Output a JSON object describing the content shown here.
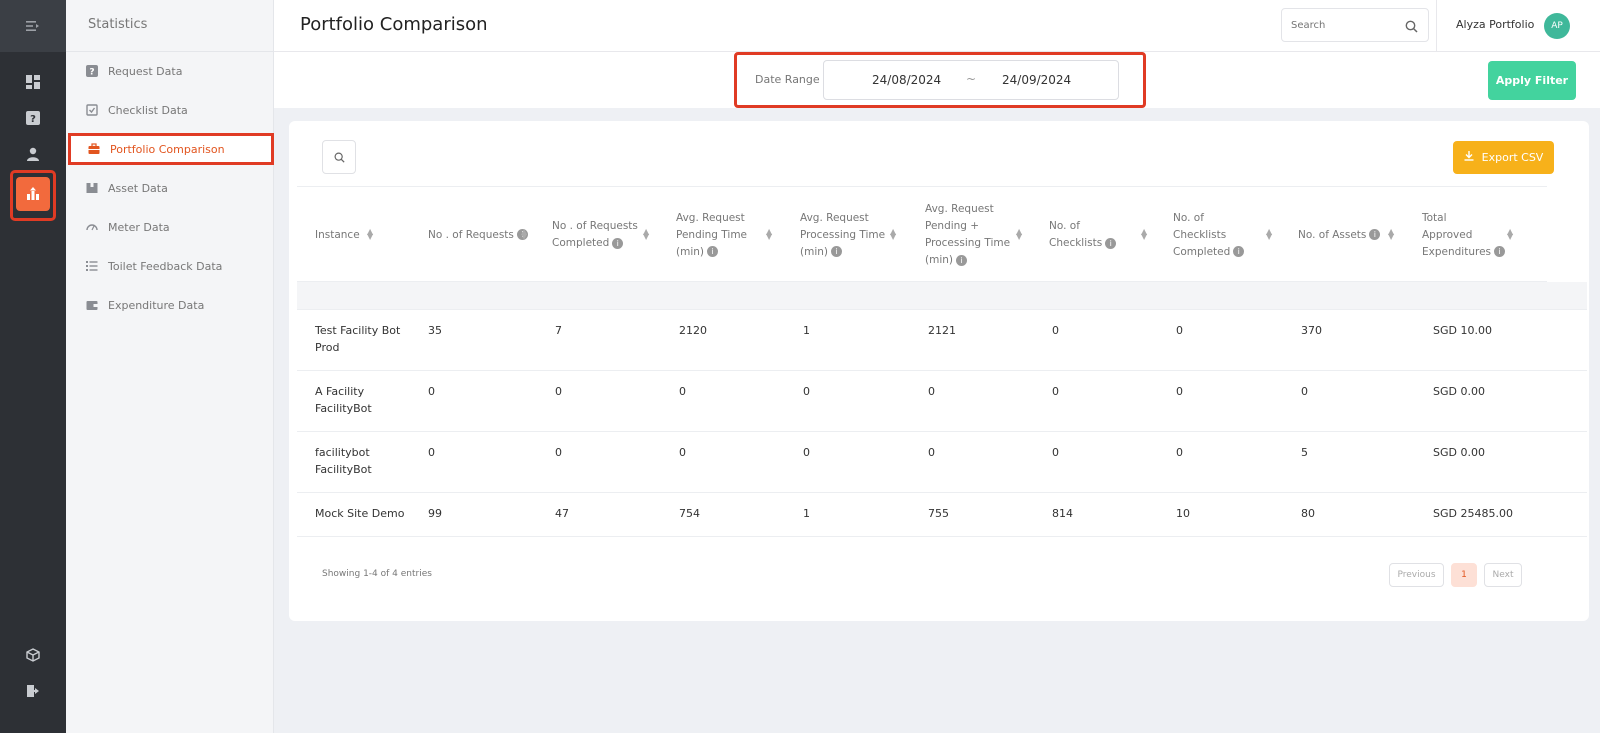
{
  "sidebar": {
    "title": "Statistics",
    "items": [
      {
        "label": "Request Data",
        "icon": "question-icon"
      },
      {
        "label": "Checklist Data",
        "icon": "checklist-icon"
      },
      {
        "label": "Portfolio Comparison",
        "icon": "briefcase-icon",
        "active": true
      },
      {
        "label": "Asset Data",
        "icon": "box-icon"
      },
      {
        "label": "Meter Data",
        "icon": "gauge-icon"
      },
      {
        "label": "Toilet Feedback Data",
        "icon": "list-icon"
      },
      {
        "label": "Expenditure Data",
        "icon": "wallet-icon"
      }
    ]
  },
  "rail": {
    "icons": [
      "menu-toggle-icon",
      "dashboard-icon",
      "help-icon",
      "user-icon",
      "statistics-icon",
      "cube-icon",
      "logout-icon"
    ],
    "active": "statistics-icon"
  },
  "header": {
    "title": "Portfolio Comparison",
    "search_placeholder": "Search",
    "user_name": "Alyza Portfolio",
    "avatar_initials": "AP"
  },
  "filter": {
    "date_range_label": "Date Range",
    "from": "24/08/2024",
    "separator": "~",
    "to": "24/09/2024",
    "apply_label": "Apply Filter"
  },
  "toolbar": {
    "export_label": "Export CSV"
  },
  "table": {
    "columns": [
      {
        "lines": [
          "Instance"
        ],
        "info": false
      },
      {
        "lines": [
          "No . of Requests"
        ],
        "info": true
      },
      {
        "lines": [
          "No . of Requests",
          "Completed"
        ],
        "info": true
      },
      {
        "lines": [
          "Avg. Request",
          "Pending Time",
          "(min)"
        ],
        "info": true
      },
      {
        "lines": [
          "Avg. Request",
          "Processing Time",
          "(min)"
        ],
        "info": true
      },
      {
        "lines": [
          "Avg. Request",
          "Pending +",
          "Processing Time",
          "(min)"
        ],
        "info": true
      },
      {
        "lines": [
          "No. of",
          "Checklists"
        ],
        "info": true
      },
      {
        "lines": [
          "No. of",
          "Checklists",
          "Completed"
        ],
        "info": true
      },
      {
        "lines": [
          "No. of Assets"
        ],
        "info": true
      },
      {
        "lines": [
          "Total",
          "Approved",
          "Expenditures"
        ],
        "info": true
      }
    ],
    "rows": [
      {
        "instance": [
          "Test Facility Bot",
          "Prod"
        ],
        "cells": [
          "35",
          "7",
          "2120",
          "1",
          "2121",
          "0",
          "0",
          "370",
          "SGD 10.00"
        ]
      },
      {
        "instance": [
          "A Facility",
          "FacilityBot"
        ],
        "cells": [
          "0",
          "0",
          "0",
          "0",
          "0",
          "0",
          "0",
          "0",
          "SGD 0.00"
        ]
      },
      {
        "instance": [
          "facilitybot",
          "FacilityBot"
        ],
        "cells": [
          "0",
          "0",
          "0",
          "0",
          "0",
          "0",
          "0",
          "5",
          "SGD 0.00"
        ]
      },
      {
        "instance": [
          "Mock Site Demo"
        ],
        "cells": [
          "99",
          "47",
          "754",
          "1",
          "755",
          "814",
          "10",
          "80",
          "SGD 25485.00"
        ]
      }
    ]
  },
  "footer": {
    "showing": "Showing 1-4 of 4 entries",
    "previous": "Previous",
    "page": "1",
    "next": "Next"
  },
  "colors": {
    "accent": "#f26a3d",
    "apply_button": "#43d39e",
    "export_button": "#f7b11a",
    "highlight_outline": "#e03b24"
  }
}
